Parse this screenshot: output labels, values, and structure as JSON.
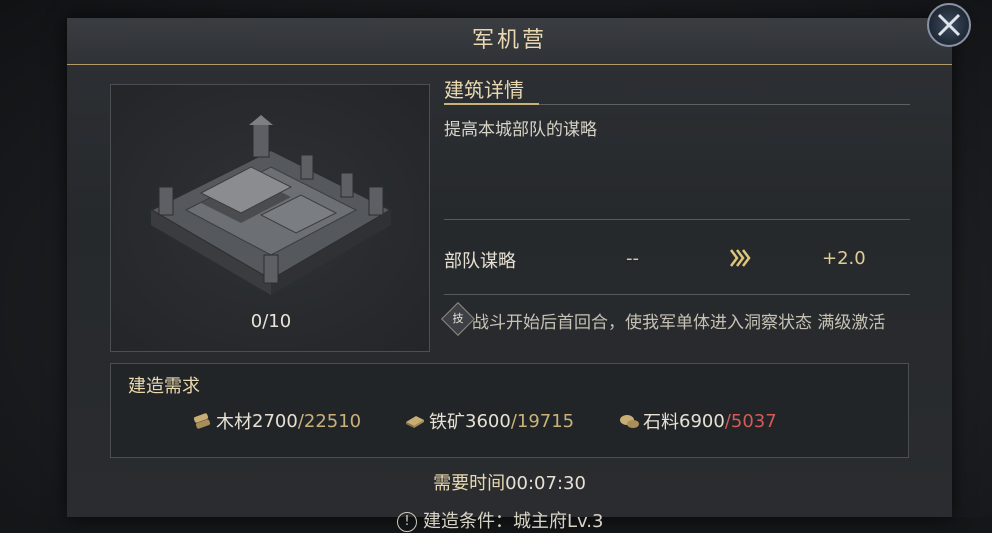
{
  "window": {
    "title": "军机营"
  },
  "building": {
    "level_text": "0/10"
  },
  "details": {
    "section_title": "建筑详情",
    "description": "提高本城部队的谋略",
    "stat": {
      "label": "部队谋略",
      "current": "--",
      "next": "+2.0"
    },
    "skill": {
      "badge": "技",
      "text": "战斗开始后首回合，使我军单体进入洞察状态  满级激活"
    }
  },
  "requirements": {
    "title": "建造需求",
    "resources": [
      {
        "name": "木材",
        "required": "2700",
        "owned": "/22510",
        "sufficient": true,
        "icon": "wood-icon"
      },
      {
        "name": "铁矿",
        "required": "3600",
        "owned": "/19715",
        "sufficient": true,
        "icon": "iron-icon"
      },
      {
        "name": "石料",
        "required": "6900",
        "owned": "/5037",
        "sufficient": false,
        "icon": "stone-icon"
      }
    ]
  },
  "time": {
    "label": "需要时间",
    "value": "00:07:30"
  },
  "condition": {
    "text": "建造条件：城主府Lv.3"
  },
  "colors": {
    "accent": "#c9b27a",
    "insufficient": "#d45a5a",
    "title": "#ead9b0"
  }
}
